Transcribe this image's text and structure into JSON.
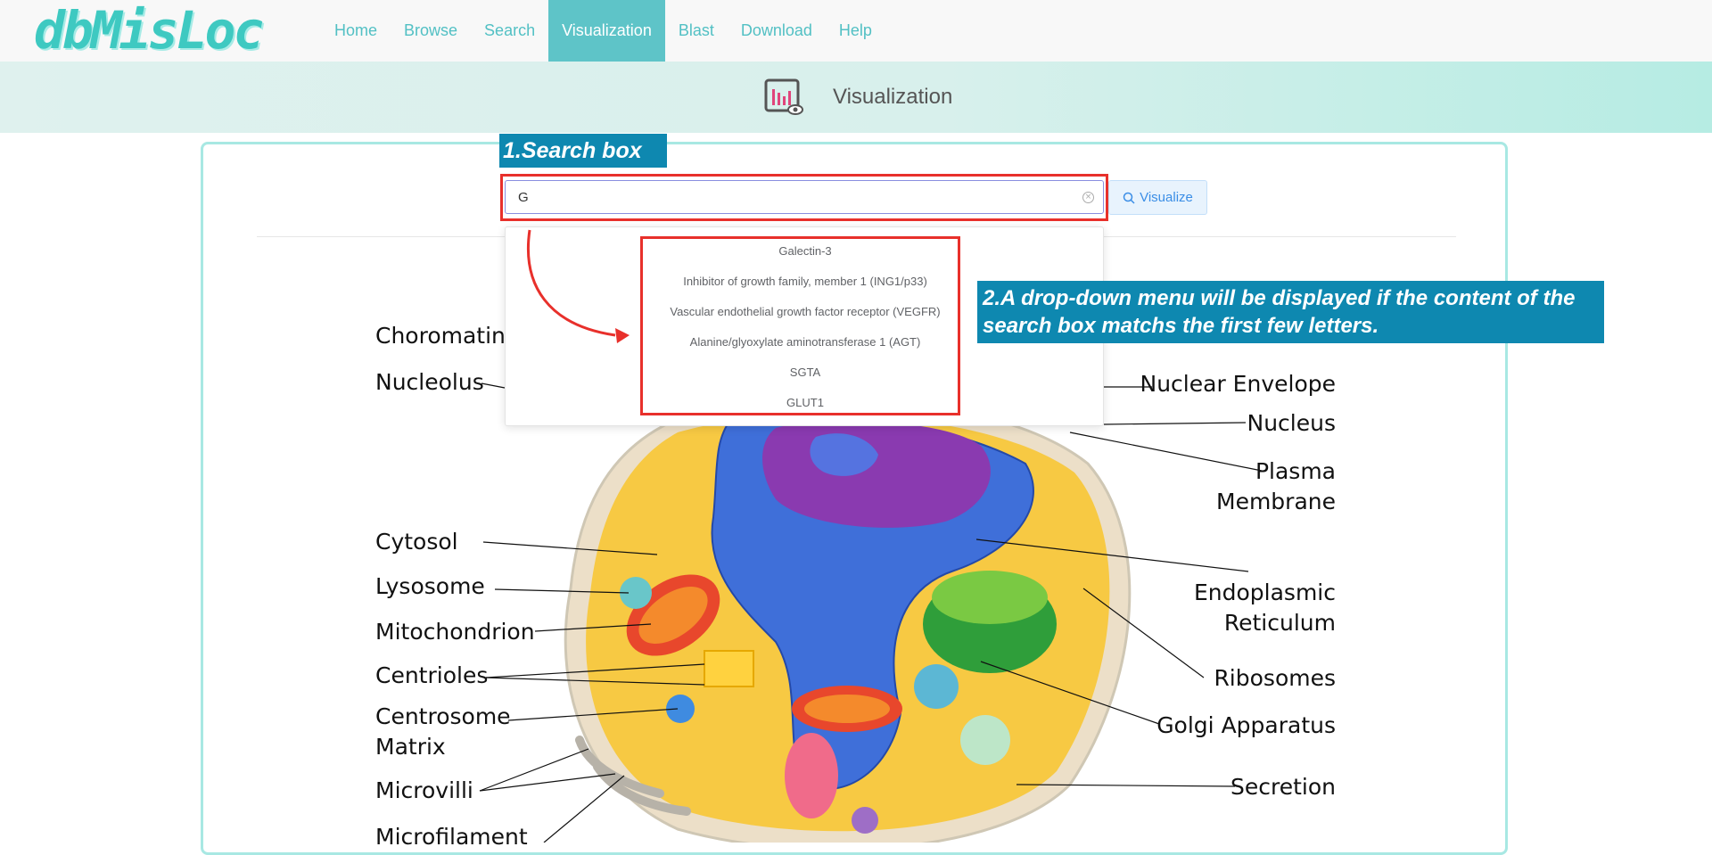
{
  "app": {
    "logo": "dbMisLoc"
  },
  "nav": [
    {
      "label": "Home"
    },
    {
      "label": "Browse"
    },
    {
      "label": "Search"
    },
    {
      "label": "Visualization",
      "active": true
    },
    {
      "label": "Blast"
    },
    {
      "label": "Download"
    },
    {
      "label": "Help"
    }
  ],
  "banner": {
    "title": "Visualization",
    "icon": "bar-chart-eye-icon"
  },
  "search": {
    "value": "G",
    "clear_icon": "circle-close-icon",
    "button_label": "Visualize",
    "button_icon": "search-icon"
  },
  "dropdown": {
    "options": [
      "Galectin-3",
      "Inhibitor of growth family, member 1 (ING1/p33)",
      "Vascular endothelial growth factor receptor (VEGFR)",
      "Alanine/glyoxylate aminotransferase 1 (AGT)",
      "SGTA",
      "GLUT1"
    ]
  },
  "annotations": {
    "search_box": "1.Search box",
    "dropdown": "2.A drop-down menu will be displayed if the content of  the search box matchs the first few letters."
  },
  "cell_labels": {
    "left": [
      "Choromatin",
      "Nucleolus",
      "Cytosol",
      "Lysosome",
      "Mitochondrion",
      "Centrioles",
      "Centrosome Matrix",
      "Microvilli",
      "Microfilament"
    ],
    "right": [
      "Nuclear Envelope",
      "Nucleus",
      "Plasma Membrane",
      "Endoplasmic Reticulum",
      "Ribosomes",
      "Golgi Apparatus",
      "Secretion"
    ]
  },
  "colors": {
    "accent": "#5ec4c8",
    "annotation_bg": "#0e88b0",
    "highlight_red": "#e8302b",
    "button_text": "#3b8ee6"
  }
}
